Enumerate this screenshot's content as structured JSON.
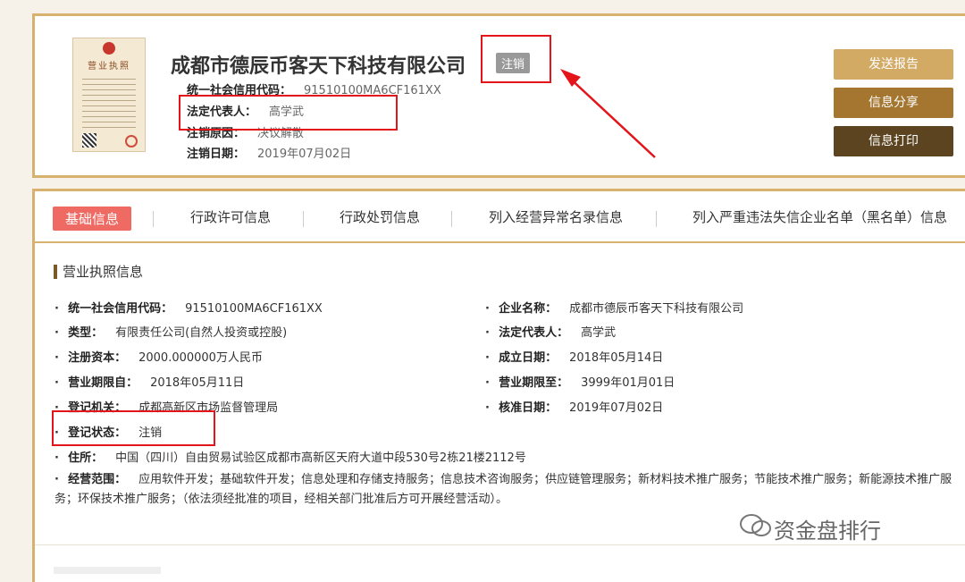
{
  "company": {
    "name": "成都市德辰币客天下科技有限公司",
    "status_tag": "注销",
    "credit_code_label": "统一社会信用代码：",
    "credit_code": "91510100MA6CF161XX",
    "legal_rep_label": "法定代表人：",
    "legal_rep": "高学武",
    "cancel_reason_label": "注销原因：",
    "cancel_reason": "决议解散",
    "cancel_date_label": "注销日期：",
    "cancel_date": "2019年07月02日"
  },
  "license_thumb": {
    "title": "营业执照"
  },
  "actions": {
    "report": "发送报告",
    "share": "信息分享",
    "print": "信息打印"
  },
  "tabs": [
    {
      "label": "基础信息"
    },
    {
      "label": "行政许可信息"
    },
    {
      "label": "行政处罚信息"
    },
    {
      "label": "列入经营异常名录信息"
    },
    {
      "label": "列入严重违法失信企业名单（黑名单）信息"
    }
  ],
  "section": {
    "title": "营业执照信息",
    "fields": {
      "credit_code": {
        "k": "统一社会信用代码：",
        "v": "91510100MA6CF161XX"
      },
      "company_name": {
        "k": "企业名称：",
        "v": "成都市德辰币客天下科技有限公司"
      },
      "type": {
        "k": "类型：",
        "v": "有限责任公司(自然人投资或控股)"
      },
      "legal_rep": {
        "k": "法定代表人：",
        "v": "高学武"
      },
      "capital": {
        "k": "注册资本：",
        "v": "2000.000000万人民币"
      },
      "established": {
        "k": "成立日期：",
        "v": "2018年05月14日"
      },
      "term_from": {
        "k": "营业期限自：",
        "v": "2018年05月11日"
      },
      "term_to": {
        "k": "营业期限至：",
        "v": "3999年01月01日"
      },
      "authority": {
        "k": "登记机关：",
        "v": "成都高新区市场监督管理局"
      },
      "approval_date": {
        "k": "核准日期：",
        "v": "2019年07月02日"
      },
      "reg_status": {
        "k": "登记状态：",
        "v": "注销"
      },
      "address": {
        "k": "住所：",
        "v": "中国（四川）自由贸易试验区成都市高新区天府大道中段530号2栋21楼2112号"
      },
      "scope": {
        "k": "经营范围：",
        "v": "应用软件开发；基础软件开发；信息处理和存储支持服务；信息技术咨询服务；供应链管理服务；新材料技术推广服务；节能技术推广服务；新能源技术推广服务；环保技术推广服务；（依法须经批准的项目，经相关部门批准后方可开展经营活动）。"
      }
    }
  },
  "watermark": {
    "text": "资金盘排行"
  },
  "colors": {
    "gold_border": "#d7b26f",
    "active_tab": "#ef6a63",
    "annotation_red": "#e4141b"
  }
}
